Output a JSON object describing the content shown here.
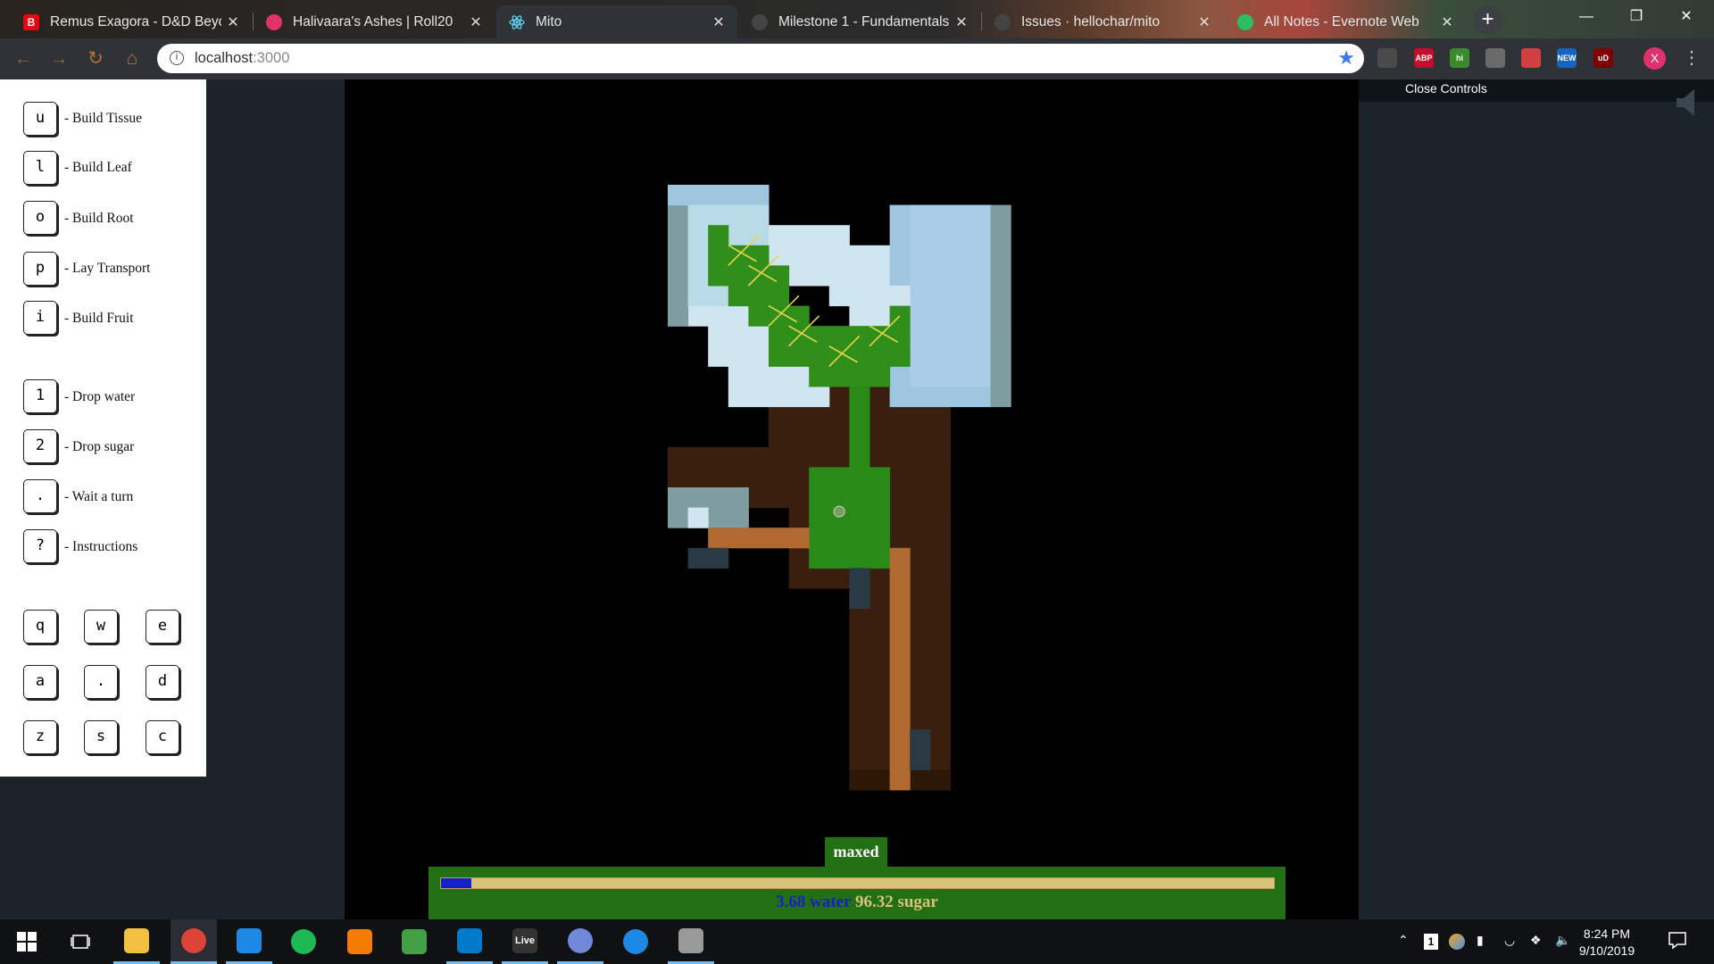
{
  "browser": {
    "tabs": [
      {
        "title": "Remus Exagora - D&D Beyon",
        "icon": "dndbeyond-icon",
        "color": "#e40712",
        "glyph": "B",
        "active": false
      },
      {
        "title": "Halivaara's Ashes | Roll20",
        "icon": "roll20-icon",
        "color": "#e0316d",
        "glyph": "",
        "active": false
      },
      {
        "title": "Mito",
        "icon": "react-icon",
        "color": "#61dafb",
        "glyph": "",
        "active": true
      },
      {
        "title": "Milestone 1 - Fundamentals",
        "icon": "github-icon",
        "color": "#444444",
        "glyph": "",
        "active": false
      },
      {
        "title": "Issues · hellochar/mito",
        "icon": "github-icon",
        "color": "#444444",
        "glyph": "",
        "active": false
      },
      {
        "title": "All Notes - Evernote Web",
        "icon": "evernote-icon",
        "color": "#2dbe60",
        "glyph": "",
        "active": false
      }
    ],
    "tab_close": "✕",
    "new_tab": "+",
    "url_host": "localhost",
    "url_port": ":3000",
    "extensions": [
      {
        "name": "extension-icon",
        "label": "",
        "color": "#4a4a4a"
      },
      {
        "name": "adblock-plus-icon",
        "label": "ABP",
        "color": "#c70d2c"
      },
      {
        "name": "honey-icon",
        "label": "hi",
        "color": "#3c8a2e"
      },
      {
        "name": "extension-card-icon",
        "label": "",
        "color": "#6a6a6a"
      },
      {
        "name": "privacy-badger-icon",
        "label": "",
        "color": "#d23f3f"
      },
      {
        "name": "new-extension-icon",
        "label": "NEW",
        "color": "#1565c0"
      },
      {
        "name": "ublock-origin-icon",
        "label": "uD",
        "color": "#800000"
      }
    ],
    "profile_initial": "X"
  },
  "controls": {
    "build": [
      {
        "key": "u",
        "label": "- Build Tissue"
      },
      {
        "key": "l",
        "label": "- Build Leaf"
      },
      {
        "key": "o",
        "label": "- Build Root"
      },
      {
        "key": "p",
        "label": "- Lay Transport"
      },
      {
        "key": "i",
        "label": "- Build Fruit"
      }
    ],
    "actions": [
      {
        "key": "1",
        "label": "- Drop water"
      },
      {
        "key": "2",
        "label": "- Drop sugar"
      },
      {
        "key": ".",
        "label": "- Wait a turn"
      },
      {
        "key": "?",
        "label": "- Instructions"
      }
    ],
    "movement": [
      "q",
      "w",
      "e",
      "a",
      ".",
      "d",
      "z",
      "s",
      "c"
    ],
    "close_label": "Close Controls"
  },
  "game": {
    "status_label": "maxed",
    "water_amount": "3.68",
    "water_label": "water",
    "sugar_amount": "96.32",
    "sugar_label": "sugar",
    "water_fraction": 0.0368,
    "colors": {
      "water": "#1520c8",
      "sugar": "#d9c27a",
      "leaf": "#2f8f1a",
      "soil": "#3a2010",
      "sky": "#8fb8d8"
    }
  },
  "taskbar": {
    "apps": [
      {
        "name": "file-explorer-taskbar-icon",
        "color": "#f0c040",
        "label": ""
      },
      {
        "name": "chrome-taskbar-icon",
        "color": "#db4437",
        "label": ""
      },
      {
        "name": "editor-taskbar-icon",
        "color": "#1e88e5",
        "label": ""
      },
      {
        "name": "spotify-taskbar-icon",
        "color": "#1db954",
        "label": ""
      },
      {
        "name": "search-app-taskbar-icon",
        "color": "#f57c00",
        "label": ""
      },
      {
        "name": "vim-taskbar-icon",
        "color": "#43a047",
        "label": ""
      },
      {
        "name": "vscode-taskbar-icon",
        "color": "#007acc",
        "label": ""
      },
      {
        "name": "live-taskbar-icon",
        "color": "#333333",
        "label": "Live"
      },
      {
        "name": "discord-taskbar-icon",
        "color": "#7289da",
        "label": ""
      },
      {
        "name": "maps-taskbar-icon",
        "color": "#1e88e5",
        "label": ""
      },
      {
        "name": "paint-taskbar-icon",
        "color": "#999999",
        "label": ""
      }
    ],
    "notification_count": "1",
    "time": "8:24 PM",
    "date": "9/10/2019"
  }
}
